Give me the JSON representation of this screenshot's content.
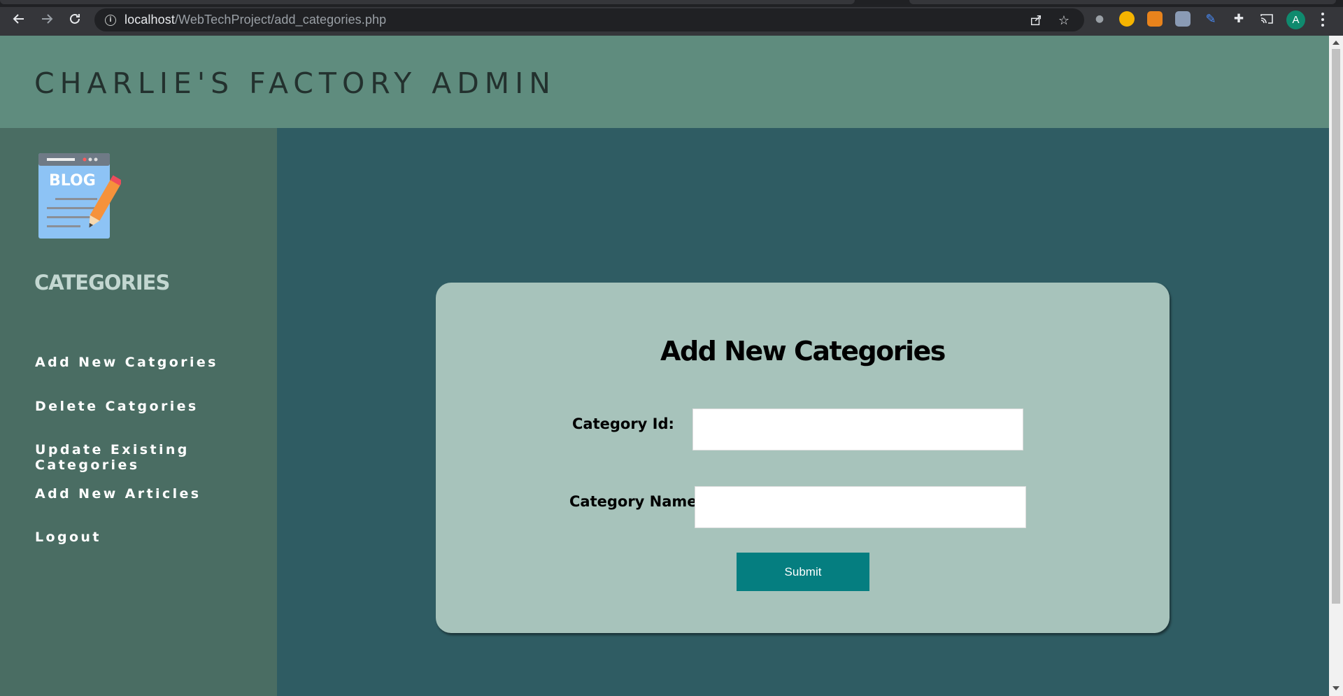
{
  "browser": {
    "url_host": "localhost",
    "url_path": "/WebTechProject/add_categories.php",
    "avatar_letter": "A"
  },
  "header": {
    "title": "CHARLIE'S FACTORY ADMIN"
  },
  "sidebar": {
    "logo_text": "BLOG",
    "heading": "CATEGORIES",
    "items": [
      {
        "label": "Add New Catgories"
      },
      {
        "label": "Delete Catgories"
      },
      {
        "label": "Update Existing Categories"
      },
      {
        "label": "Add New Articles"
      },
      {
        "label": "Logout"
      }
    ]
  },
  "form": {
    "title": "Add New Categories",
    "category_id_label": "Category Id:",
    "category_id_value": "",
    "category_name_label": "Category Name:",
    "category_name_value": "",
    "submit_label": "Submit"
  },
  "colors": {
    "header_bg": "#5f8c7e",
    "sidebar_bg": "#4a6d63",
    "main_bg": "#2f5c63",
    "card_bg": "#a7c3bb",
    "button_bg": "#057e80"
  }
}
